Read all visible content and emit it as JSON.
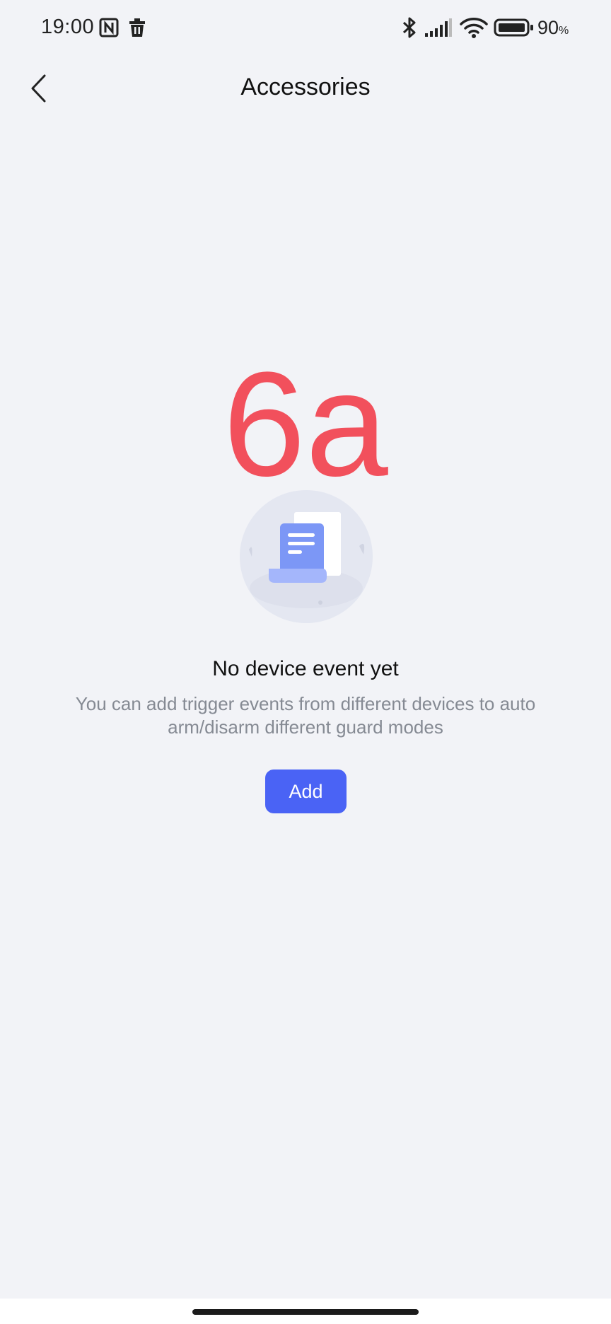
{
  "status_bar": {
    "time": "19:00",
    "battery_percent": "90",
    "battery_unit": "%",
    "icons": [
      "nfc-icon",
      "trash-icon",
      "bluetooth-icon",
      "signal-icon",
      "wifi-icon",
      "battery-icon"
    ]
  },
  "header": {
    "title": "Accessories",
    "back_icon": "chevron-left-icon"
  },
  "overlay": {
    "big_text": "6a",
    "color": "#f2505c"
  },
  "empty_state": {
    "illustration": "document-scroll-icon",
    "title": "No device event yet",
    "description": "You can add trigger events from different devices to auto arm/disarm different guard modes",
    "add_button_label": "Add"
  },
  "colors": {
    "background": "#f2f3f7",
    "accent": "#4a63f5",
    "secondary_text": "#858a93"
  }
}
